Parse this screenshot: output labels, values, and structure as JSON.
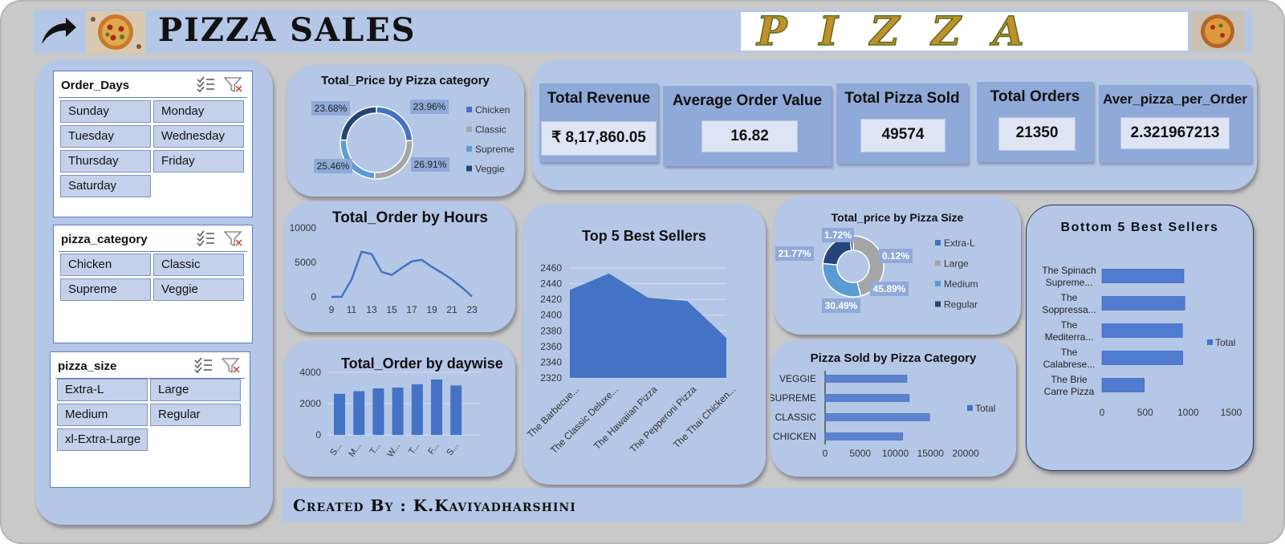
{
  "header": {
    "title": "PIZZA SALES",
    "banner_text": "PIZZA"
  },
  "slicers": {
    "order_days": {
      "title": "Order_Days",
      "items": [
        "Sunday",
        "Monday",
        "Tuesday",
        "Wednesday",
        "Thursday",
        "Friday",
        "Saturday"
      ]
    },
    "pizza_category": {
      "title": "pizza_category",
      "items": [
        "Chicken",
        "Classic",
        "Supreme",
        "Veggie"
      ]
    },
    "pizza_size": {
      "title": "pizza_size",
      "items": [
        "Extra-L",
        "Large",
        "Medium",
        "Regular",
        "xl-Extra-Large"
      ]
    }
  },
  "kpis": [
    {
      "label": "Total Revenue",
      "value": "₹ 8,17,860.05"
    },
    {
      "label": "Average Order Value",
      "value": "16.82"
    },
    {
      "label": "Total Pizza Sold",
      "value": "49574"
    },
    {
      "label": "Total Orders",
      "value": "21350"
    },
    {
      "label": "Aver_pizza_per_Order",
      "value": "2.321967213"
    }
  ],
  "chart_data": [
    {
      "id": "price_by_category",
      "type": "pie",
      "title": "Total_Price by Pizza category",
      "categories": [
        "Chicken",
        "Classic",
        "Supreme",
        "Veggie"
      ],
      "values": [
        23.96,
        26.91,
        25.46,
        23.68
      ],
      "labels": [
        "23.96%",
        "26.91%",
        "25.46%",
        "23.68%"
      ],
      "colors": [
        "#4472c4",
        "#a5a5a5",
        "#5b9bd5",
        "#264478"
      ],
      "legend": "right"
    },
    {
      "id": "order_by_hours",
      "type": "line",
      "title": "Total_Order by Hours",
      "x": [
        9,
        10,
        11,
        12,
        13,
        14,
        15,
        16,
        17,
        18,
        19,
        20,
        21,
        22,
        23
      ],
      "xticks": [
        "9",
        "11",
        "13",
        "15",
        "17",
        "19",
        "21",
        "23"
      ],
      "values": [
        1,
        8,
        2520,
        6543,
        6203,
        3613,
        3170,
        4185,
        5143,
        5359,
        4350,
        3487,
        2528,
        1370,
        68
      ],
      "yticks": [
        "0",
        "5000",
        "10000"
      ],
      "ylim": [
        0,
        10000
      ],
      "color": "#4472c4"
    },
    {
      "id": "order_by_daywise",
      "type": "bar",
      "title": "Total_Order by daywise",
      "categories": [
        "S...",
        "M...",
        "T...",
        "W...",
        "T...",
        "F...",
        "S..."
      ],
      "values": [
        2624,
        2794,
        2973,
        3024,
        3239,
        3538,
        3158
      ],
      "yticks": [
        "0",
        "2000",
        "4000"
      ],
      "ylim": [
        0,
        4000
      ],
      "color": "#4472c4"
    },
    {
      "id": "top5",
      "type": "area",
      "title": "Top 5 Best Sellers",
      "categories": [
        "The Barbecue...",
        "The Classic Deluxe...",
        "The Hawaiian Pizza",
        "The Pepperoni Pizza",
        "The Thai Chicken..."
      ],
      "values": [
        2432,
        2453,
        2422,
        2418,
        2371
      ],
      "yticks": [
        "2320",
        "2340",
        "2360",
        "2380",
        "2400",
        "2420",
        "2440",
        "2460"
      ],
      "ylim": [
        2320,
        2460
      ],
      "color": "#4472c4"
    },
    {
      "id": "price_by_size",
      "type": "pie",
      "title": "Total_price by Pizza Size",
      "categories": [
        "Extra-L",
        "Large",
        "Medium",
        "Regular"
      ],
      "values": [
        0.12,
        45.89,
        30.49,
        21.77,
        1.72
      ],
      "slice_names": [
        "Extra-L",
        "Large",
        "Medium",
        "Regular",
        "xl-Extra-Large"
      ],
      "labels": [
        "0.12%",
        "45.89%",
        "30.49%",
        "21.77%",
        "1.72%"
      ],
      "colors": [
        "#4472c4",
        "#a5a5a5",
        "#5b9bd5",
        "#264478",
        "#1f3864"
      ],
      "legend": "right"
    },
    {
      "id": "sold_by_category",
      "type": "bar",
      "orientation": "horizontal",
      "title": "Pizza Sold by Pizza Category",
      "categories": [
        "VEGGIE",
        "SUPREME",
        "CLASSIC",
        "CHICKEN"
      ],
      "series": [
        {
          "name": "Total",
          "values": [
            11649,
            11987,
            14888,
            11050
          ]
        }
      ],
      "xticks": [
        "0",
        "5000",
        "10000",
        "15000",
        "20000"
      ],
      "xlim": [
        0,
        20000
      ],
      "color": "#4472c4",
      "legend": "right"
    },
    {
      "id": "bottom5",
      "type": "bar",
      "orientation": "horizontal",
      "title": "Bottom 5 Best Sellers",
      "categories": [
        [
          "The Spinach",
          "Supreme..."
        ],
        [
          "The",
          "Soppressa..."
        ],
        [
          "The",
          "Mediterra..."
        ],
        [
          "The",
          "Calabrese..."
        ],
        [
          "The Brie",
          "Carre Pizza"
        ]
      ],
      "series": [
        {
          "name": "Total",
          "values": [
            950,
            961,
            934,
            937,
            490
          ]
        }
      ],
      "xticks": [
        "0",
        "500",
        "1000",
        "1500"
      ],
      "xlim": [
        0,
        1500
      ],
      "color": "#4472c4",
      "legend": "right"
    }
  ],
  "footer": {
    "text": "Created By : K.Kaviyadharshini"
  }
}
